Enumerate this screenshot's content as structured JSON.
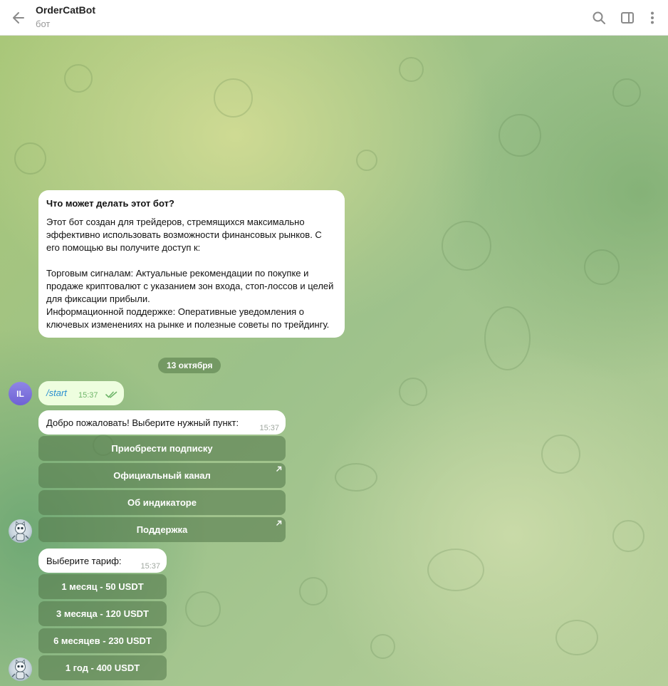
{
  "header": {
    "title": "OrderCatBot",
    "subtitle": "бот"
  },
  "info": {
    "title": "Что может делать этот бот?",
    "text": "Этот бот создан для трейдеров, стремящихся максимально эффективно использовать возможности финансовых рынков. С его помощью вы получите доступ к:\n\nТорговым сигналам: Актуальные рекомендации по покупке и продаже криптовалют с указанием зон входа, стоп-лоссов и целей для фиксации прибыли.\nИнформационной поддержке: Оперативные уведомления о ключевых изменениях на рынке и полезные советы по трейдингу."
  },
  "date_chip": "13 октября",
  "user": {
    "initials": "IL",
    "message": "/start",
    "time": "15:37"
  },
  "bot_msg1": {
    "text": "Добро пожаловать! Выберите нужный пункт:",
    "time": "15:37",
    "buttons": [
      {
        "label": "Приобрести подписку",
        "external": false
      },
      {
        "label": "Официальный канал",
        "external": true
      },
      {
        "label": "Об индикаторе",
        "external": false
      },
      {
        "label": "Поддержка",
        "external": true
      }
    ]
  },
  "bot_msg2": {
    "text": "Выберите тариф:",
    "time": "15:37",
    "buttons": [
      {
        "label": "1 месяц - 50 USDT"
      },
      {
        "label": "3 месяца - 120 USDT"
      },
      {
        "label": "6 месяцев - 230 USDT"
      },
      {
        "label": "1 год - 400 USDT"
      }
    ]
  },
  "icons": {
    "back": "arrow-left-icon",
    "search": "search-icon",
    "sidebar": "sidebar-toggle-icon",
    "menu": "more-vertical-icon",
    "external": "external-link-arrow-icon",
    "read": "double-check-icon"
  },
  "colors": {
    "header_bg": "#ffffff",
    "bubble_in": "#ffffff",
    "bubble_out": "#eefedf",
    "keyboard_button": "#55784b",
    "link": "#2a8fd0",
    "user_avatar": "#7a6fe0"
  }
}
